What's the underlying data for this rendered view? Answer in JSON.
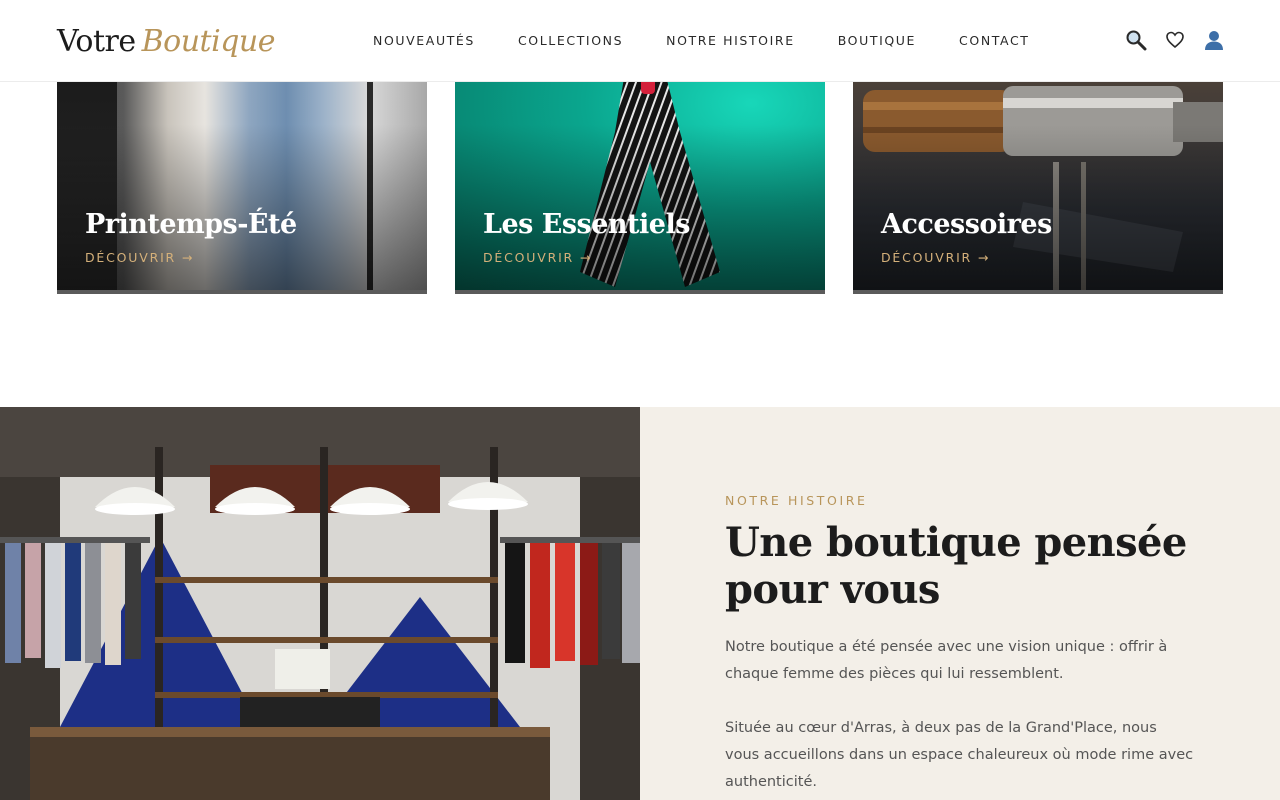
{
  "header": {
    "logo_main": "Votre",
    "logo_accent": "Boutique",
    "nav": [
      "NOUVEAUTÉS",
      "COLLECTIONS",
      "NOTRE HISTOIRE",
      "BOUTIQUE",
      "CONTACT"
    ],
    "icons": [
      "search-icon",
      "heart-icon",
      "user-icon"
    ]
  },
  "collections": [
    {
      "title": "Printemps-Été",
      "link": "DÉCOUVRIR →"
    },
    {
      "title": "Les Essentiels",
      "link": "DÉCOUVRIR →"
    },
    {
      "title": "Accessoires",
      "link": "DÉCOUVRIR →"
    }
  ],
  "story": {
    "eyebrow": "NOTRE HISTOIRE",
    "title": "Une boutique pensée pour vous",
    "paragraph_1": "Notre boutique a été pensée avec une vision unique : offrir à chaque femme des pièces qui lui ressemblent.",
    "paragraph_2": "Située au cœur d'Arras, à deux pas de la Grand'Place, nous vous accueillons dans un espace chaleureux où mode rime avec authenticité."
  },
  "colors": {
    "accent": "#b8955a",
    "panel": "#f3efe8",
    "text": "#1c1c1c"
  }
}
